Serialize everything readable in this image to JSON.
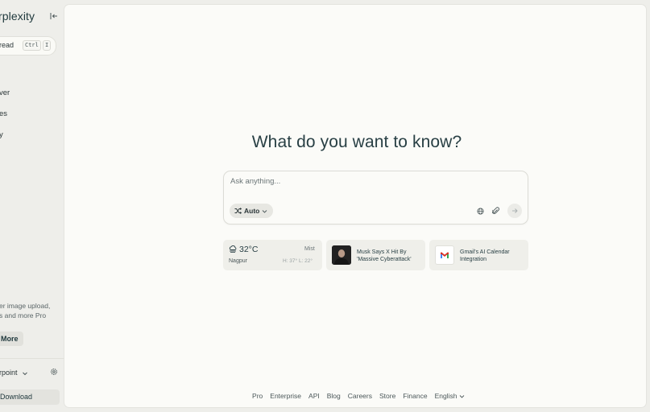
{
  "sidebar": {
    "logo_text": "rplexity",
    "new_thread_label": "read",
    "shortcut_ctrl": "Ctrl",
    "shortcut_key": "I",
    "nav_items": [
      {
        "label": "ver",
        "icon": "compass-icon"
      },
      {
        "label": "es",
        "icon": "spaces-icon"
      },
      {
        "label": "y",
        "icon": "library-icon"
      }
    ],
    "promo_line1": "er image upload,",
    "promo_line2": "s and more Pro",
    "more_label": "More",
    "account_label": "rpoint",
    "download_label": "Download"
  },
  "main": {
    "headline": "What do you want to know?",
    "search": {
      "placeholder": "Ask anything...",
      "mode_label": "Auto"
    },
    "cards": {
      "weather": {
        "temp": "32°C",
        "condition": "Mist",
        "city": "Nagpur",
        "hilo": "H: 37° L: 22°"
      },
      "news": [
        {
          "title": "Musk Says X Hit By 'Massive Cyberattack'"
        },
        {
          "title": "Gmail's AI Calendar Integration"
        }
      ]
    },
    "footer": {
      "links": [
        "Pro",
        "Enterprise",
        "API",
        "Blog",
        "Careers",
        "Store",
        "Finance"
      ],
      "language": "English"
    }
  },
  "colors": {
    "brand_text": "#283f44",
    "sidebar_bg": "#eeeeea",
    "main_bg": "#fbfbf8",
    "card_bg": "#efefea"
  }
}
